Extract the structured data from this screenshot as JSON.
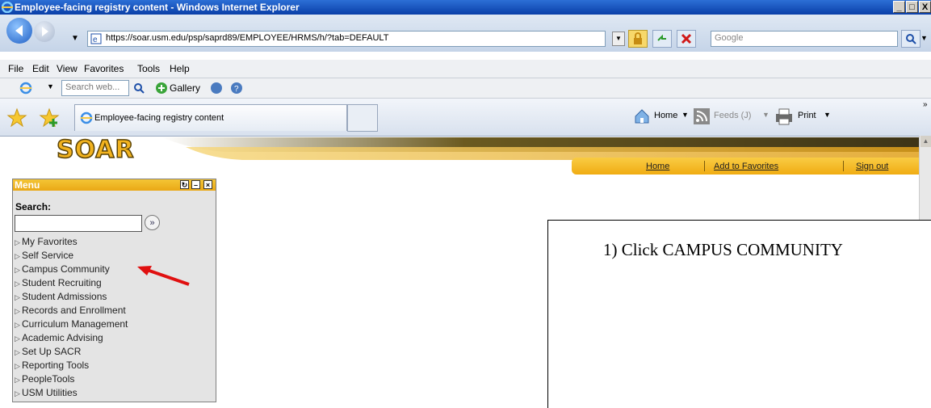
{
  "window": {
    "title": "Employee-facing registry content - Windows Internet Explorer",
    "controls": [
      "_",
      "Ɛ",
      "X"
    ]
  },
  "address": {
    "url": "https://soar.usm.edu/psp/saprd89/EMPLOYEE/HRMS/h/?tab=DEFAULT",
    "search_placeholder": "Google"
  },
  "menubar": {
    "items": [
      "File",
      "Edit",
      "View",
      "Favorites",
      "Tools",
      "Help"
    ]
  },
  "links_bar": {
    "search_placeholder": "Search web...",
    "gallery": "Gallery"
  },
  "tab": {
    "label": "Employee-facing registry content"
  },
  "command_bar": {
    "home": "Home",
    "feeds": "Feeds (J)",
    "print": "Print"
  },
  "site": {
    "logo": "SOAR",
    "top_links": [
      "Home",
      "Add to Favorites",
      "Sign out"
    ]
  },
  "menu_panel": {
    "title": "Menu",
    "search_label": "Search:",
    "go_symbol": "»",
    "items": [
      "My Favorites",
      "Self Service",
      "Campus Community",
      "Student Recruiting",
      "Student Admissions",
      "Records and Enrollment",
      "Curriculum Management",
      "Academic Advising",
      "Set Up SACR",
      "Reporting Tools",
      "PeopleTools",
      "USM Utilities"
    ]
  },
  "instruction": {
    "text": "1)  Click CAMPUS COMMUNITY"
  },
  "colors": {
    "accent": "#f0ac12",
    "arrow": "#e01010",
    "titlebar": "#0a3fa8"
  }
}
